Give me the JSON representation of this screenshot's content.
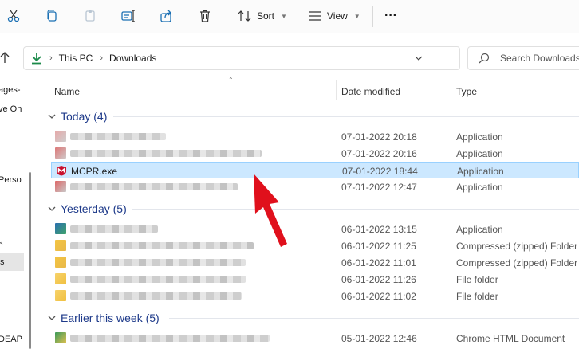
{
  "toolbar": {
    "icons": [
      "cut-icon",
      "copy-icon",
      "paste-icon",
      "rename-icon",
      "share-icon",
      "delete-icon",
      "more-icon"
    ],
    "sort_label": "Sort",
    "view_label": "View",
    "more_label": "···"
  },
  "address": {
    "crumbs": [
      "This PC",
      "Downloads"
    ]
  },
  "search": {
    "placeholder": "Search Downloads"
  },
  "nav": {
    "items": [
      "ages-",
      "ve On",
      "Perso",
      "s",
      "s",
      "DEAP"
    ]
  },
  "columns": {
    "name": "Name",
    "date": "Date modified",
    "type": "Type"
  },
  "groups": [
    {
      "label": "Today (4)",
      "rows": [
        {
          "name": "",
          "date": "07-01-2022 20:18",
          "type": "Application"
        },
        {
          "name": "",
          "date": "07-01-2022 20:16",
          "type": "Application"
        },
        {
          "name": "MCPR.exe",
          "date": "07-01-2022 18:44",
          "type": "Application"
        },
        {
          "name": "",
          "date": "07-01-2022 12:47",
          "type": "Application"
        }
      ]
    },
    {
      "label": "Yesterday (5)",
      "rows": [
        {
          "name": "",
          "date": "06-01-2022 13:15",
          "type": "Application"
        },
        {
          "name": "",
          "date": "06-01-2022 11:25",
          "type": "Compressed (zipped) Folder"
        },
        {
          "name": "",
          "date": "06-01-2022 11:01",
          "type": "Compressed (zipped) Folder"
        },
        {
          "name": "",
          "date": "06-01-2022 11:26",
          "type": "File folder"
        },
        {
          "name": "",
          "date": "06-01-2022 11:02",
          "type": "File folder"
        }
      ]
    },
    {
      "label": "Earlier this week (5)",
      "rows": [
        {
          "name": "",
          "date": "05-01-2022 12:46",
          "type": "Chrome HTML Document"
        }
      ]
    }
  ],
  "colors": {
    "accent_group": "#1e3a8a",
    "selection_bg": "#cce8ff",
    "selection_border": "#99d1ff",
    "arrow": "#e0101c"
  }
}
